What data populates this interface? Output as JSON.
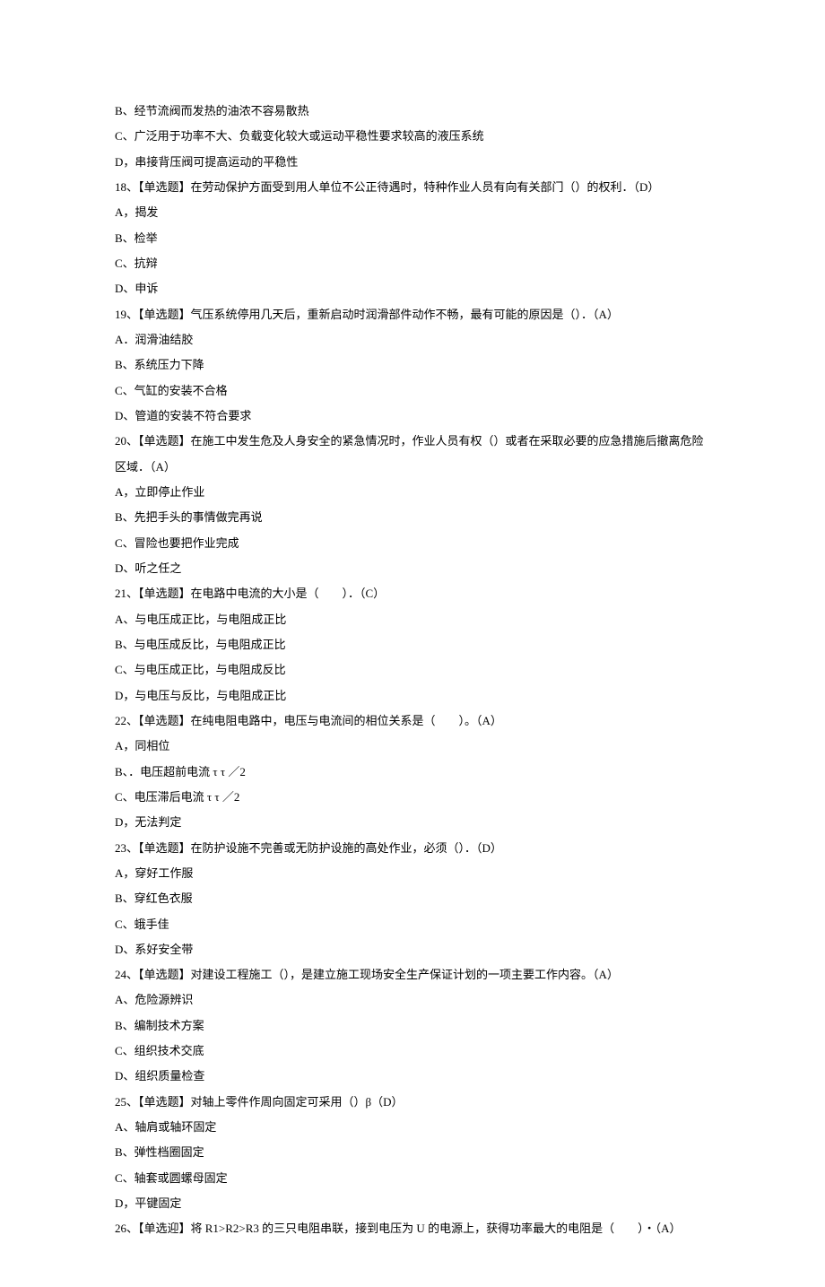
{
  "lines": [
    "B、经节流阀而发热的油浓不容易散热",
    "C、广泛用于功率不大、负载变化较大或运动平稳性要求较高的液压系统",
    "D，串接背压阀可提高运动的平稳性",
    "18、【单选题】在劳动保护方面受到用人单位不公正待遇时，特种作业人员有向有关部门（）的权利．（D）",
    "A，揭发",
    "B、检举",
    "C、抗辩",
    "D、申诉",
    "19、【单选题】气压系统停用几天后，重新启动时润滑部件动作不畅，最有可能的原因是（）．（A）",
    "A．润滑油结胶",
    "B、系统压力下降",
    "C、气缸的安装不合格",
    "D、管道的安装不符合要求",
    "20、【单选题】在施工中发生危及人身安全的紧急情况时，作业人员有权（）或者在采取必要的应急措施后撤离危险区域．（A）",
    "A，立即停止作业",
    "B、先把手头的事情做完再说",
    "C、冒险也要把作业完成",
    "D、听之任之",
    "21、【单选题】在电路中电流的大小是（　　）．（C）",
    "A、与电压成正比，与电阻成正比",
    "B、与电压成反比，与电阻成正比",
    "C、与电压成正比，与电阻成反比",
    "D，与电压与反比，与电阻成正比",
    "22、【单选题】在纯电阻电路中，电压与电流间的相位关系是（　　）。（A）",
    "A，同相位",
    "B、．电压超前电流 τ τ ／2",
    "C、电压滞后电流 τ τ ／2",
    "D，无法判定",
    "23、【单选题】在防护设施不完善或无防护设施的高处作业，必须（）．（D）",
    "A，穿好工作服",
    "B、穿红色衣服",
    "C、蛾手佳",
    "D、系好安全带",
    "24、【单选题】对建设工程施工（），是建立施工现场安全生产保证计划的一项主要工作内容。（A）",
    "A、危险源辨识",
    "B、编制技术方案",
    "C、组织技术交底",
    "D、组织质量检查",
    "25、【单选题】对轴上零件作周向固定可采用（）β（D）",
    "A、轴肩或轴环固定",
    "B、弹性档圈固定",
    "C、轴套或圆螺母固定",
    "D，平键固定",
    "26、【单选迎】将 R1>R2>R3 的三只电阻串联，接到电压为 U 的电源上，获得功率最大的电阻是（　　）・（A）"
  ]
}
